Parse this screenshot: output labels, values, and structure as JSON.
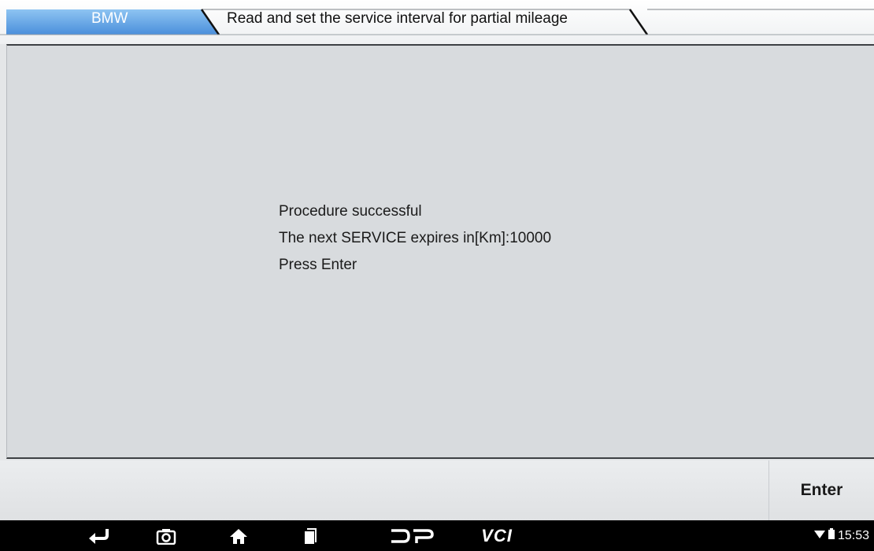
{
  "breadcrumb": {
    "brand": "BMW",
    "function": "Read and set the service interval for partial mileage"
  },
  "message": {
    "lines": [
      "Procedure successful",
      "The next SERVICE expires in[Km]:10000",
      "Press Enter"
    ]
  },
  "actions": {
    "enter_label": "Enter"
  },
  "navbar": {
    "icons": [
      "back-icon",
      "screenshot-icon",
      "home-icon",
      "recent-apps-icon",
      "dp-icon",
      "vci-icon"
    ],
    "vci_label": "VCI",
    "dp_label": "DP"
  },
  "status": {
    "time": "15:53",
    "icons": [
      "wifi-icon",
      "battery-icon"
    ]
  },
  "colors": {
    "brand_tab": "#5b9fe0",
    "panel": "#d8dbde",
    "navbar": "#000000"
  }
}
